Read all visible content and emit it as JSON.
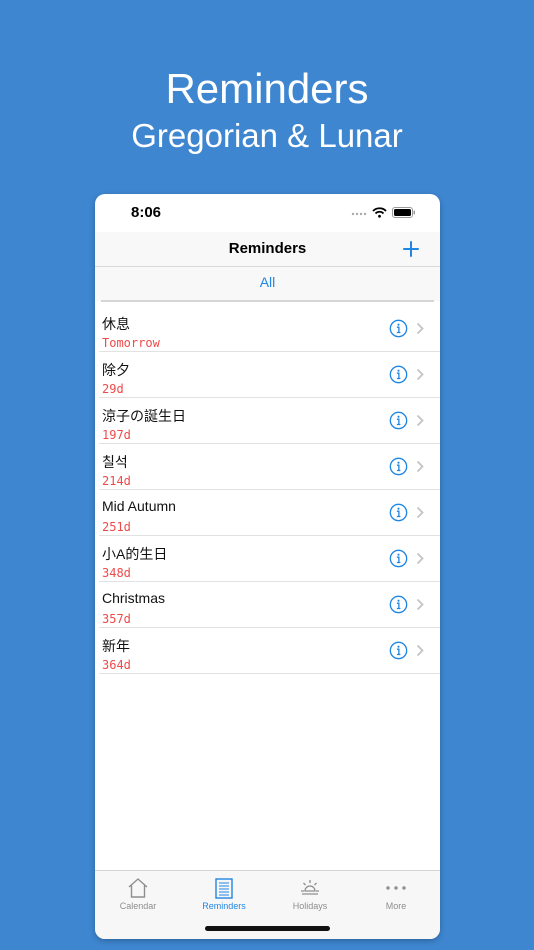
{
  "promo": {
    "title": "Reminders",
    "subtitle": "Gregorian & Lunar"
  },
  "status_bar": {
    "time": "8:06"
  },
  "nav": {
    "title": "Reminders",
    "add_icon": "plus-icon"
  },
  "segment": {
    "selected": "All"
  },
  "reminders": [
    {
      "name": "休息",
      "days": "Tomorrow"
    },
    {
      "name": "除夕",
      "days": "29d"
    },
    {
      "name": "涼子の誕生日",
      "days": "197d"
    },
    {
      "name": "칠석",
      "days": "214d"
    },
    {
      "name": "Mid Autumn",
      "days": "251d"
    },
    {
      "name": "小A的生日",
      "days": "348d"
    },
    {
      "name": "Christmas",
      "days": "357d"
    },
    {
      "name": "新年",
      "days": "364d"
    }
  ],
  "tabs": [
    {
      "label": "Calendar",
      "icon": "house-icon"
    },
    {
      "label": "Reminders",
      "icon": "notepad-icon",
      "active": true
    },
    {
      "label": "Holidays",
      "icon": "sun-icon"
    },
    {
      "label": "More",
      "icon": "ellipsis-icon"
    }
  ],
  "colors": {
    "background": "#3e86d0",
    "accent": "#1f86e5",
    "days_text": "#ef4a4a"
  }
}
